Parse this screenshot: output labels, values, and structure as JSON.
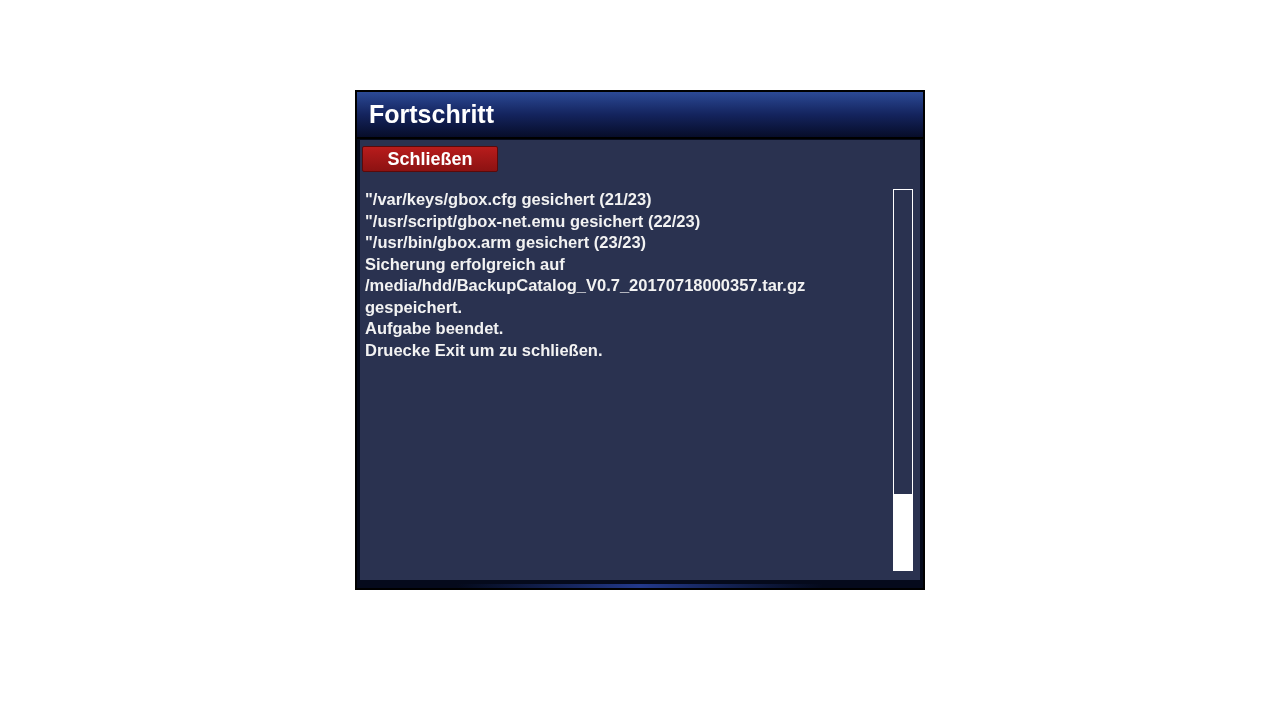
{
  "window": {
    "title": "Fortschritt"
  },
  "close_button": {
    "label": "Schließen"
  },
  "log_lines": [
    "\"/var/keys/gbox.cfg gesichert (21/23)",
    "\"/usr/script/gbox-net.emu gesichert (22/23)",
    "\"/usr/bin/gbox.arm gesichert (23/23)",
    "Sicherung erfolgreich auf",
    "/media/hdd/BackupCatalog_V0.7_20170718000357.tar.gz",
    "gespeichert.",
    "Aufgabe beendet.",
    "Druecke Exit um zu schließen."
  ]
}
